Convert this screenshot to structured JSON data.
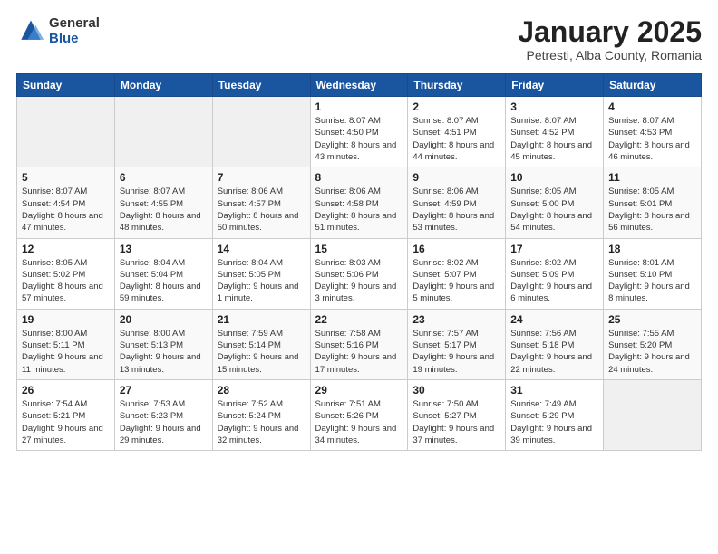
{
  "logo": {
    "general": "General",
    "blue": "Blue"
  },
  "header": {
    "title": "January 2025",
    "subtitle": "Petresti, Alba County, Romania"
  },
  "weekdays": [
    "Sunday",
    "Monday",
    "Tuesday",
    "Wednesday",
    "Thursday",
    "Friday",
    "Saturday"
  ],
  "weeks": [
    [
      {
        "day": "",
        "sunrise": "",
        "sunset": "",
        "daylight": ""
      },
      {
        "day": "",
        "sunrise": "",
        "sunset": "",
        "daylight": ""
      },
      {
        "day": "",
        "sunrise": "",
        "sunset": "",
        "daylight": ""
      },
      {
        "day": "1",
        "sunrise": "Sunrise: 8:07 AM",
        "sunset": "Sunset: 4:50 PM",
        "daylight": "Daylight: 8 hours and 43 minutes."
      },
      {
        "day": "2",
        "sunrise": "Sunrise: 8:07 AM",
        "sunset": "Sunset: 4:51 PM",
        "daylight": "Daylight: 8 hours and 44 minutes."
      },
      {
        "day": "3",
        "sunrise": "Sunrise: 8:07 AM",
        "sunset": "Sunset: 4:52 PM",
        "daylight": "Daylight: 8 hours and 45 minutes."
      },
      {
        "day": "4",
        "sunrise": "Sunrise: 8:07 AM",
        "sunset": "Sunset: 4:53 PM",
        "daylight": "Daylight: 8 hours and 46 minutes."
      }
    ],
    [
      {
        "day": "5",
        "sunrise": "Sunrise: 8:07 AM",
        "sunset": "Sunset: 4:54 PM",
        "daylight": "Daylight: 8 hours and 47 minutes."
      },
      {
        "day": "6",
        "sunrise": "Sunrise: 8:07 AM",
        "sunset": "Sunset: 4:55 PM",
        "daylight": "Daylight: 8 hours and 48 minutes."
      },
      {
        "day": "7",
        "sunrise": "Sunrise: 8:06 AM",
        "sunset": "Sunset: 4:57 PM",
        "daylight": "Daylight: 8 hours and 50 minutes."
      },
      {
        "day": "8",
        "sunrise": "Sunrise: 8:06 AM",
        "sunset": "Sunset: 4:58 PM",
        "daylight": "Daylight: 8 hours and 51 minutes."
      },
      {
        "day": "9",
        "sunrise": "Sunrise: 8:06 AM",
        "sunset": "Sunset: 4:59 PM",
        "daylight": "Daylight: 8 hours and 53 minutes."
      },
      {
        "day": "10",
        "sunrise": "Sunrise: 8:05 AM",
        "sunset": "Sunset: 5:00 PM",
        "daylight": "Daylight: 8 hours and 54 minutes."
      },
      {
        "day": "11",
        "sunrise": "Sunrise: 8:05 AM",
        "sunset": "Sunset: 5:01 PM",
        "daylight": "Daylight: 8 hours and 56 minutes."
      }
    ],
    [
      {
        "day": "12",
        "sunrise": "Sunrise: 8:05 AM",
        "sunset": "Sunset: 5:02 PM",
        "daylight": "Daylight: 8 hours and 57 minutes."
      },
      {
        "day": "13",
        "sunrise": "Sunrise: 8:04 AM",
        "sunset": "Sunset: 5:04 PM",
        "daylight": "Daylight: 8 hours and 59 minutes."
      },
      {
        "day": "14",
        "sunrise": "Sunrise: 8:04 AM",
        "sunset": "Sunset: 5:05 PM",
        "daylight": "Daylight: 9 hours and 1 minute."
      },
      {
        "day": "15",
        "sunrise": "Sunrise: 8:03 AM",
        "sunset": "Sunset: 5:06 PM",
        "daylight": "Daylight: 9 hours and 3 minutes."
      },
      {
        "day": "16",
        "sunrise": "Sunrise: 8:02 AM",
        "sunset": "Sunset: 5:07 PM",
        "daylight": "Daylight: 9 hours and 5 minutes."
      },
      {
        "day": "17",
        "sunrise": "Sunrise: 8:02 AM",
        "sunset": "Sunset: 5:09 PM",
        "daylight": "Daylight: 9 hours and 6 minutes."
      },
      {
        "day": "18",
        "sunrise": "Sunrise: 8:01 AM",
        "sunset": "Sunset: 5:10 PM",
        "daylight": "Daylight: 9 hours and 8 minutes."
      }
    ],
    [
      {
        "day": "19",
        "sunrise": "Sunrise: 8:00 AM",
        "sunset": "Sunset: 5:11 PM",
        "daylight": "Daylight: 9 hours and 11 minutes."
      },
      {
        "day": "20",
        "sunrise": "Sunrise: 8:00 AM",
        "sunset": "Sunset: 5:13 PM",
        "daylight": "Daylight: 9 hours and 13 minutes."
      },
      {
        "day": "21",
        "sunrise": "Sunrise: 7:59 AM",
        "sunset": "Sunset: 5:14 PM",
        "daylight": "Daylight: 9 hours and 15 minutes."
      },
      {
        "day": "22",
        "sunrise": "Sunrise: 7:58 AM",
        "sunset": "Sunset: 5:16 PM",
        "daylight": "Daylight: 9 hours and 17 minutes."
      },
      {
        "day": "23",
        "sunrise": "Sunrise: 7:57 AM",
        "sunset": "Sunset: 5:17 PM",
        "daylight": "Daylight: 9 hours and 19 minutes."
      },
      {
        "day": "24",
        "sunrise": "Sunrise: 7:56 AM",
        "sunset": "Sunset: 5:18 PM",
        "daylight": "Daylight: 9 hours and 22 minutes."
      },
      {
        "day": "25",
        "sunrise": "Sunrise: 7:55 AM",
        "sunset": "Sunset: 5:20 PM",
        "daylight": "Daylight: 9 hours and 24 minutes."
      }
    ],
    [
      {
        "day": "26",
        "sunrise": "Sunrise: 7:54 AM",
        "sunset": "Sunset: 5:21 PM",
        "daylight": "Daylight: 9 hours and 27 minutes."
      },
      {
        "day": "27",
        "sunrise": "Sunrise: 7:53 AM",
        "sunset": "Sunset: 5:23 PM",
        "daylight": "Daylight: 9 hours and 29 minutes."
      },
      {
        "day": "28",
        "sunrise": "Sunrise: 7:52 AM",
        "sunset": "Sunset: 5:24 PM",
        "daylight": "Daylight: 9 hours and 32 minutes."
      },
      {
        "day": "29",
        "sunrise": "Sunrise: 7:51 AM",
        "sunset": "Sunset: 5:26 PM",
        "daylight": "Daylight: 9 hours and 34 minutes."
      },
      {
        "day": "30",
        "sunrise": "Sunrise: 7:50 AM",
        "sunset": "Sunset: 5:27 PM",
        "daylight": "Daylight: 9 hours and 37 minutes."
      },
      {
        "day": "31",
        "sunrise": "Sunrise: 7:49 AM",
        "sunset": "Sunset: 5:29 PM",
        "daylight": "Daylight: 9 hours and 39 minutes."
      },
      {
        "day": "",
        "sunrise": "",
        "sunset": "",
        "daylight": ""
      }
    ]
  ]
}
